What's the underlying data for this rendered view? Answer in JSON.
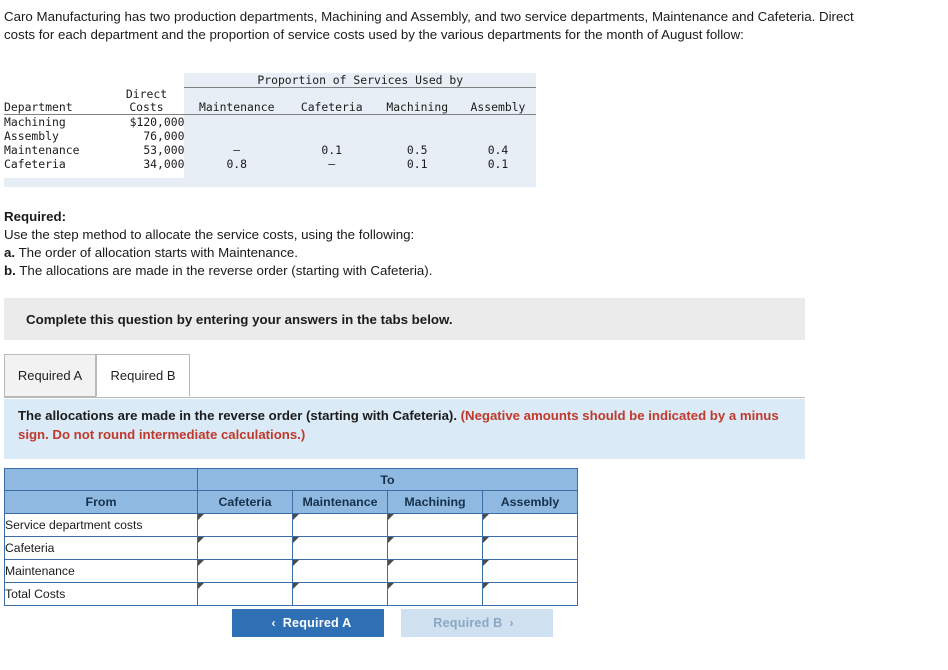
{
  "intro": "Caro Manufacturing has two production departments, Machining and Assembly, and two service departments, Maintenance and Cafeteria. Direct costs for each department and the proportion of service costs used by the various departments for the month of August follow:",
  "data_table": {
    "group_header": "Proportion of Services Used by",
    "columns": [
      "Department",
      "Direct Costs",
      "Maintenance",
      "Cafeteria",
      "Machining",
      "Assembly"
    ],
    "col_department": "Department",
    "col_direct_line1": "Direct",
    "col_direct_line2": "Costs",
    "col_maintenance": "Maintenance",
    "col_cafeteria": "Cafeteria",
    "col_machining": "Machining",
    "col_assembly": "Assembly",
    "rows": [
      {
        "department": "Machining",
        "direct_costs": "$120,000",
        "maintenance": "",
        "cafeteria": "",
        "machining": "",
        "assembly": ""
      },
      {
        "department": "Assembly",
        "direct_costs": "76,000",
        "maintenance": "",
        "cafeteria": "",
        "machining": "",
        "assembly": ""
      },
      {
        "department": "Maintenance",
        "direct_costs": "53,000",
        "maintenance": "–",
        "cafeteria": "0.1",
        "machining": "0.5",
        "assembly": "0.4"
      },
      {
        "department": "Cafeteria",
        "direct_costs": "34,000",
        "maintenance": "0.8",
        "cafeteria": "–",
        "machining": "0.1",
        "assembly": "0.1"
      }
    ]
  },
  "required": {
    "heading": "Required:",
    "line1": "Use the step method to allocate the service costs, using the following:",
    "a_label": "a.",
    "a_text": "The order of allocation starts with Maintenance.",
    "b_label": "b.",
    "b_text": "The allocations are made in the reverse order (starting with Cafeteria)."
  },
  "banner": "Complete this question by entering your answers in the tabs below.",
  "tabs": [
    {
      "label": "Required A",
      "active": false
    },
    {
      "label": "Required B",
      "active": true
    }
  ],
  "info": {
    "main": "The allocations are made in the reverse order (starting with Cafeteria).",
    "note": "(Negative amounts should be indicated by a minus sign. Do not round intermediate calculations.)"
  },
  "answer_table": {
    "to_header": "To",
    "from_header": "From",
    "columns": [
      "Cafeteria",
      "Maintenance",
      "Machining",
      "Assembly"
    ],
    "rows": [
      {
        "label": "Service department costs",
        "values": [
          "",
          "",
          "",
          ""
        ]
      },
      {
        "label": "Cafeteria",
        "values": [
          "",
          "",
          "",
          ""
        ]
      },
      {
        "label": "Maintenance",
        "values": [
          "",
          "",
          "",
          ""
        ]
      },
      {
        "label": "Total Costs",
        "values": [
          "",
          "",
          "",
          ""
        ]
      }
    ]
  },
  "nav": {
    "prev_label": "Required A",
    "next_label": "Required B",
    "prev_chevron": "‹",
    "next_chevron": "›"
  },
  "colors": {
    "table_shade": "#e8eef5",
    "banner": "#ebebeb",
    "info_strip": "#dbeaf7",
    "accent_blue": "#2f6fb3",
    "header_blue": "#8fb9e0",
    "red_note": "#c0392b"
  }
}
